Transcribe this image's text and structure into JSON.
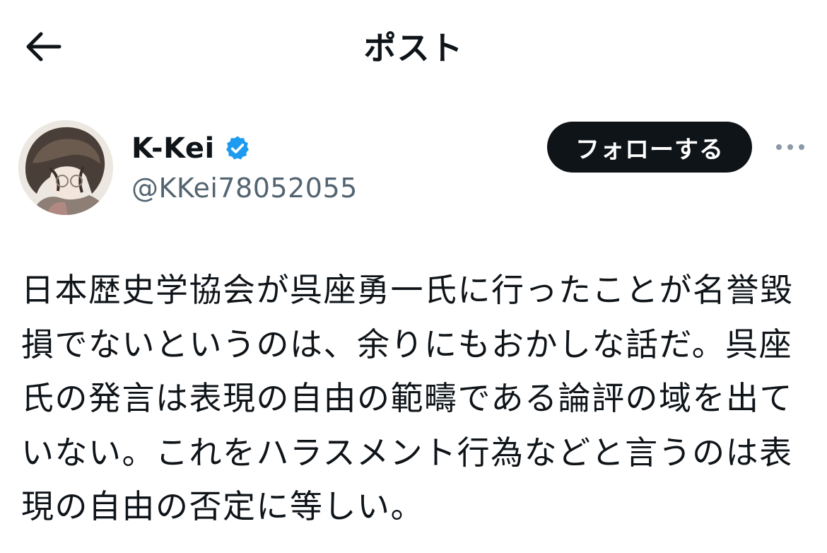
{
  "header": {
    "title": "ポスト",
    "back_icon": "arrow-left-icon"
  },
  "author": {
    "display_name": "K-Kei",
    "handle": "@KKei78052055",
    "verified": true,
    "verified_icon": "verified-badge-icon",
    "verified_color": "#1d9bf0",
    "follow_label": "フォローする",
    "more_icon": "more-horizontal-icon"
  },
  "post": {
    "lines": [
      "日本歴史学協会が呉座勇一氏に行ったことが名誉毀",
      "損でないというのは、余りにもおかしな話だ。呉座",
      "氏の発言は表現の自由の範疇である論評の域を出て",
      "いない。これをハラスメント行為などと言うのは表",
      "現の自由の否定に等しい。"
    ]
  },
  "colors": {
    "text": "#0f1419",
    "secondary": "#536471",
    "button_bg": "#0f1419",
    "button_text": "#ffffff"
  }
}
